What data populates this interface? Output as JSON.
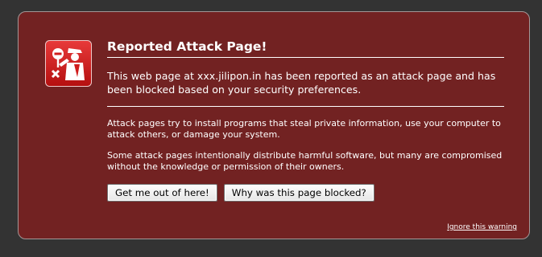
{
  "warning": {
    "title": "Reported Attack Page!",
    "intro": "This web page at xxx.jilipon.in has been reported as an attack page and has been blocked based on your security preferences.",
    "detail_1": "Attack pages try to install programs that steal private information, use your computer to attack others, or damage your system.",
    "detail_2": "Some attack pages intentionally distribute harmful software, but many are compromised without the knowledge or permission of their owners.",
    "get_out_label": "Get me out of here!",
    "why_blocked_label": "Why was this page blocked?",
    "ignore_label": "Ignore this warning"
  },
  "colors": {
    "background": "#333333",
    "panel": "#722222",
    "icon_red": "#d01c1c",
    "text": "#ffffff"
  },
  "icons": {
    "badge": "police-officer-stop-icon"
  }
}
